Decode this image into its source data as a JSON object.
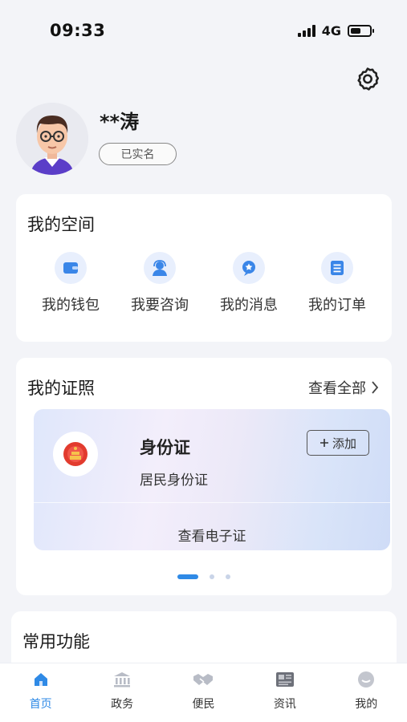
{
  "status_bar": {
    "time": "09:33",
    "network": "4G"
  },
  "user": {
    "name": "**涛",
    "badge": "已实名"
  },
  "my_space": {
    "title": "我的空间",
    "items": [
      {
        "label": "我的钱包",
        "icon": "wallet-icon"
      },
      {
        "label": "我要咨询",
        "icon": "consult-icon"
      },
      {
        "label": "我的消息",
        "icon": "message-icon"
      },
      {
        "label": "我的订单",
        "icon": "order-icon"
      }
    ]
  },
  "certificates": {
    "title": "我的证照",
    "view_all": "查看全部",
    "card": {
      "title": "身份证",
      "subtitle": "居民身份证",
      "add_label": "添加",
      "view_label": "查看电子证"
    },
    "pager": {
      "count": 3,
      "active": 0
    }
  },
  "common_functions": {
    "title": "常用功能"
  },
  "tabs": [
    {
      "label": "首页",
      "icon": "home-icon",
      "active": true
    },
    {
      "label": "政务",
      "icon": "government-icon",
      "active": false
    },
    {
      "label": "便民",
      "icon": "handshake-icon",
      "active": false
    },
    {
      "label": "资讯",
      "icon": "news-icon",
      "active": false
    },
    {
      "label": "我的",
      "icon": "profile-icon",
      "active": false
    }
  ],
  "colors": {
    "accent": "#2f8ae6",
    "background": "#f3f4f8",
    "icon_bg": "#e8effd"
  }
}
